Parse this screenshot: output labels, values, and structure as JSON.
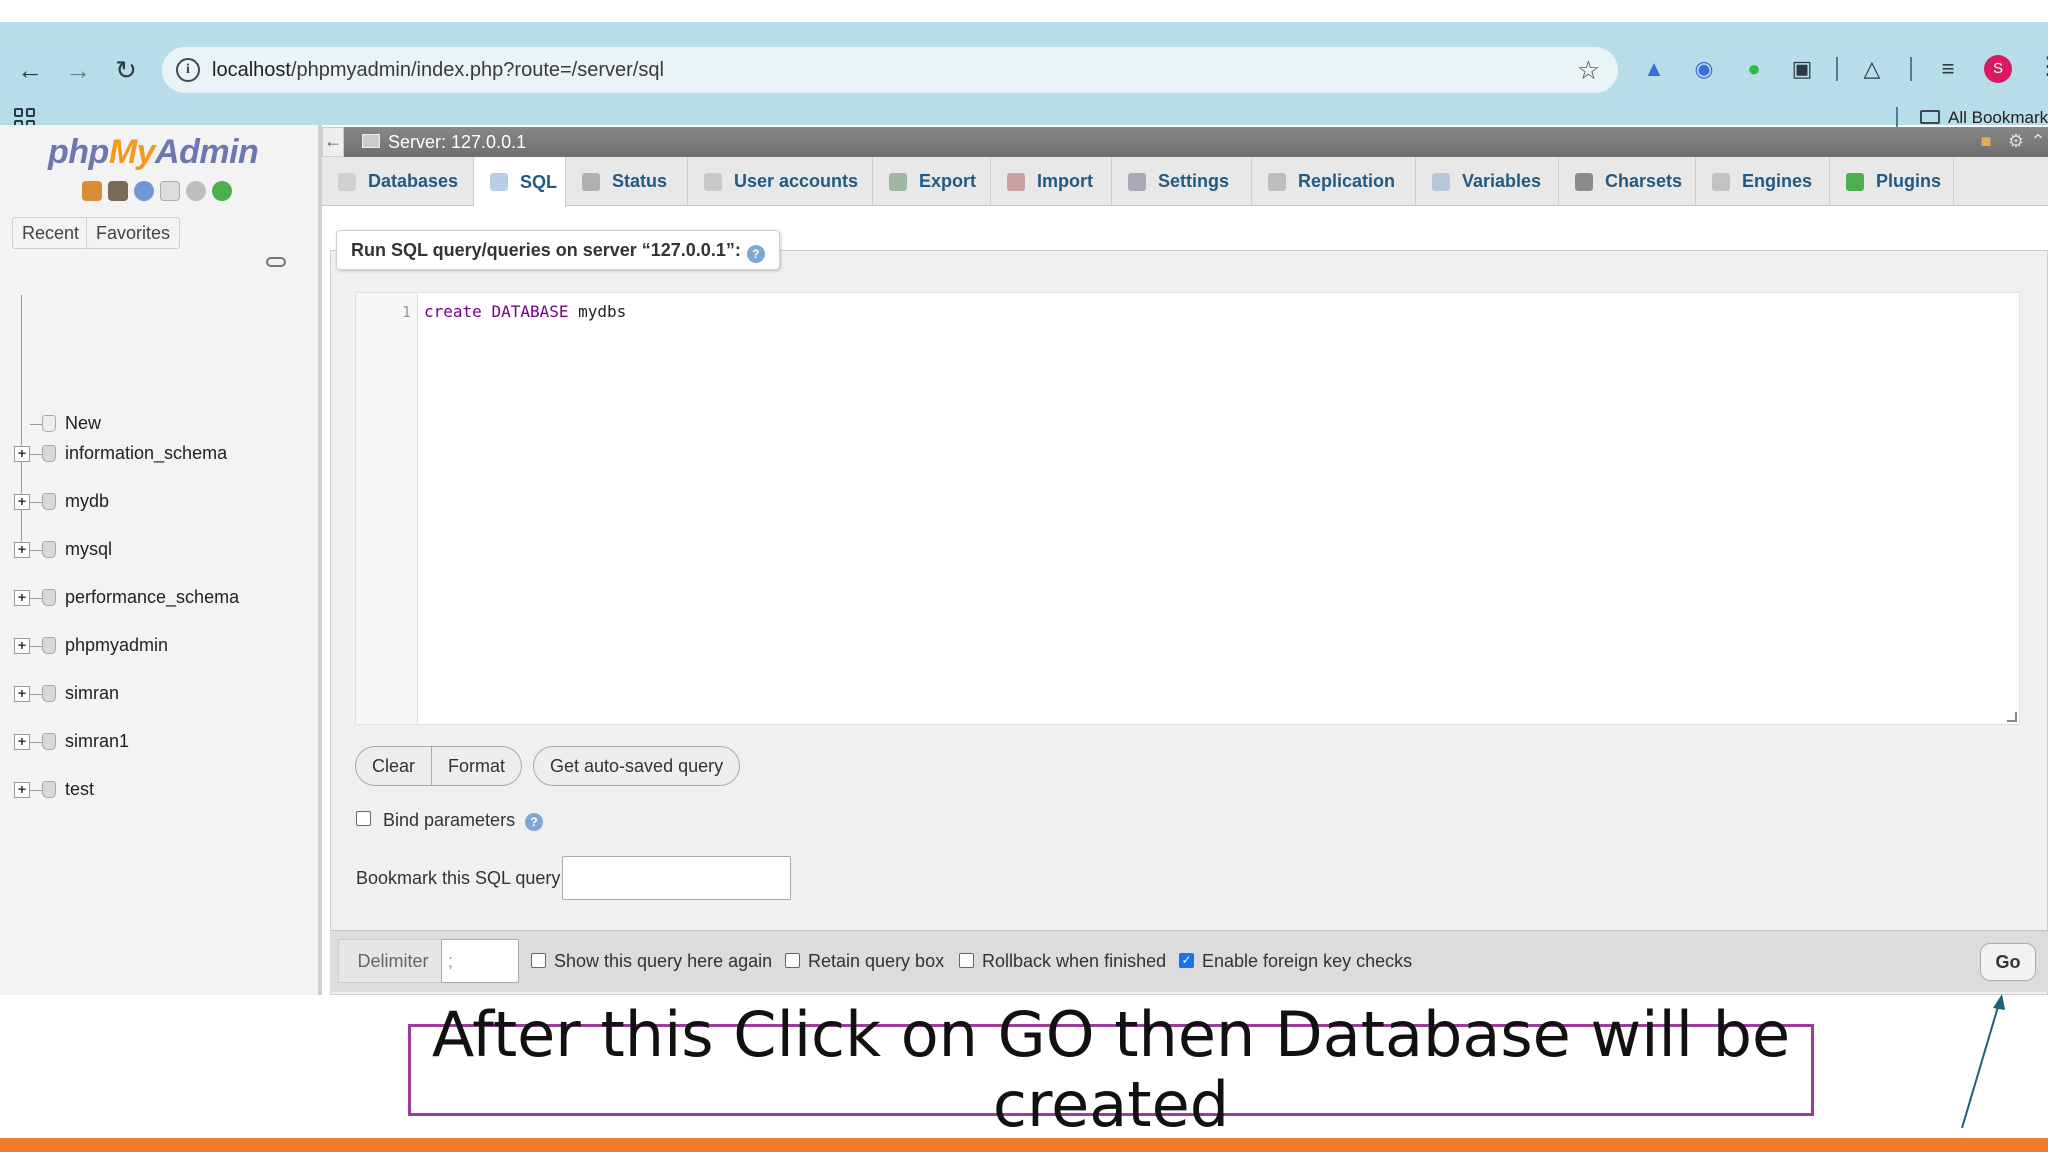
{
  "browser": {
    "url_host": "localhost",
    "url_path": "/phpmyadmin/index.php?route=/server/sql",
    "profile_initial": "S",
    "bookmarks_label": "All Bookmark"
  },
  "pma": {
    "logo_php": "php",
    "logo_my": "My",
    "logo_admin": "Admin",
    "recent_label": "Recent",
    "favorites_label": "Favorites",
    "tree": {
      "new_label": "New",
      "databases": [
        "information_schema",
        "mydb",
        "mysql",
        "performance_schema",
        "phpmyadmin",
        "simran",
        "simran1",
        "test"
      ]
    },
    "server_label": "Server: 127.0.0.1",
    "tabs": [
      "Databases",
      "SQL",
      "Status",
      "User accounts",
      "Export",
      "Import",
      "Settings",
      "Replication",
      "Variables",
      "Charsets",
      "Engines",
      "Plugins"
    ],
    "active_tab": "SQL",
    "legend": "Run SQL query/queries on server “127.0.0.1”:",
    "editor": {
      "line_number": "1",
      "code_kw1": "create",
      "code_kw2": "DATABASE",
      "code_rest": "mydbs"
    },
    "buttons": {
      "clear": "Clear",
      "format": "Format",
      "autosaved": "Get auto-saved query",
      "go": "Go"
    },
    "bind_parameters": "Bind parameters",
    "bookmark_label": "Bookmark this SQL query:",
    "delimiter_label": "Delimiter",
    "delimiter_value": ";",
    "options": {
      "show_again": "Show this query here again",
      "retain_box": "Retain query box",
      "rollback": "Rollback when finished",
      "foreign_keys": "Enable foreign key checks"
    }
  },
  "annotation": {
    "caption": "After this Click on GO then Database will be created",
    "accent_color": "#9b3d9b",
    "arrow_color": "#1f5f7a",
    "footer_color": "#ec7d2a"
  },
  "icons": [
    "back-icon",
    "forward-icon",
    "reload-icon",
    "info-icon",
    "star-icon",
    "extension-icon",
    "lab-icon",
    "reading-list-icon",
    "kebab-icon",
    "apps-icon",
    "folder-icon",
    "help-icon",
    "link-icon"
  ]
}
